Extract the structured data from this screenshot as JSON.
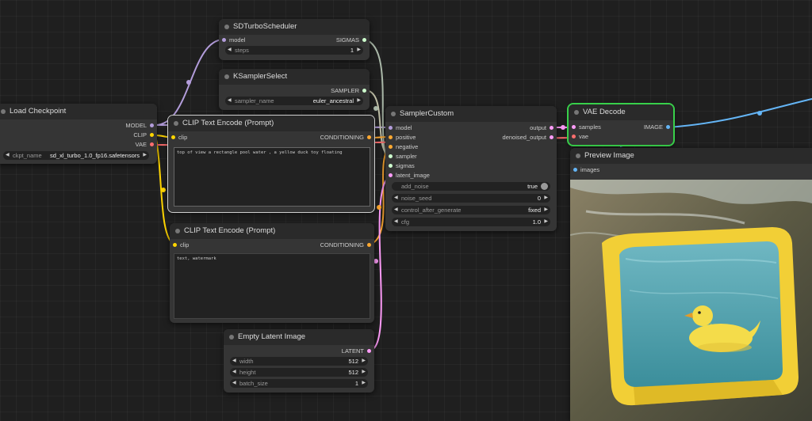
{
  "colors": {
    "model": "#b39ddb",
    "clip": "#ffd500",
    "vae": "#ff6e6e",
    "conditioning": "#ffa931",
    "sampler": "#ecb4b4",
    "sigmas": "#cdffcd",
    "latent": "#ff9cf9",
    "image": "#64b5f6",
    "active_outline": "#38d04a"
  },
  "nodes": {
    "sdturbo": {
      "title": "SDTurboScheduler",
      "input_model": "model",
      "output_sigmas": "SIGMAS",
      "steps_label": "steps",
      "steps_value": "1"
    },
    "ksampler_select": {
      "title": "KSamplerSelect",
      "output_sampler": "SAMPLER",
      "sampler_name_label": "sampler_name",
      "sampler_name_value": "euler_ancestral"
    },
    "load_checkpoint": {
      "title": "Load Checkpoint",
      "out_model": "MODEL",
      "out_clip": "CLIP",
      "out_vae": "VAE",
      "ckpt_label": "ckpt_name",
      "ckpt_value": "sd_xl_turbo_1.0_fp16.safetensors"
    },
    "clip_pos": {
      "title": "CLIP Text Encode (Prompt)",
      "input_clip": "clip",
      "output_cond": "CONDITIONING",
      "text": "top of view a rectangle pool water , a yellow duck toy floating"
    },
    "clip_neg": {
      "title": "CLIP Text Encode (Prompt)",
      "input_clip": "clip",
      "output_cond": "CONDITIONING",
      "text": "text, watermark"
    },
    "sampler_custom": {
      "title": "SamplerCustom",
      "in_model": "model",
      "in_positive": "positive",
      "in_negative": "negative",
      "in_sampler": "sampler",
      "in_sigmas": "sigmas",
      "in_latent": "latent_image",
      "out_output": "output",
      "out_denoised": "denoised_output",
      "add_noise_label": "add_noise",
      "add_noise_value": "true",
      "noise_seed_label": "noise_seed",
      "noise_seed_value": "0",
      "control_label": "control_after_generate",
      "control_value": "fixed",
      "cfg_label": "cfg",
      "cfg_value": "1.0"
    },
    "vae_decode": {
      "title": "VAE Decode",
      "in_samples": "samples",
      "in_vae": "vae",
      "out_image": "IMAGE"
    },
    "preview": {
      "title": "Preview Image",
      "in_images": "images"
    },
    "empty_latent": {
      "title": "Empty Latent Image",
      "out_latent": "LATENT",
      "width_label": "width",
      "width_value": "512",
      "height_label": "height",
      "height_value": "512",
      "batch_label": "batch_size",
      "batch_value": "1"
    }
  }
}
